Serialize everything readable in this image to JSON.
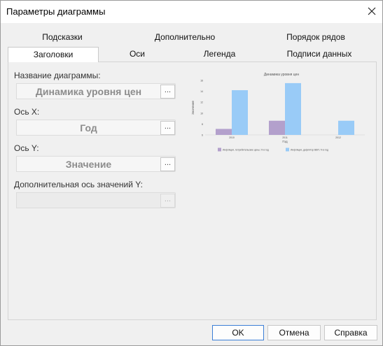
{
  "window": {
    "title": "Параметры диаграммы"
  },
  "tabs_row1": [
    "Подсказки",
    "Дополнительно",
    "Порядок рядов"
  ],
  "tabs_row2": [
    "Заголовки",
    "Оси",
    "Легенда",
    "Подписи данных"
  ],
  "fields": {
    "chart_title": {
      "label": "Название диаграммы:",
      "value": "Динамика уровня цен"
    },
    "x_axis": {
      "label": "Ось X:",
      "value": "Год"
    },
    "y_axis": {
      "label": "Ось Y:",
      "value": "Значение"
    },
    "extra_axis": {
      "label": "Дополнительная ось значений Y:",
      "value": ""
    },
    "browse": "..."
  },
  "chart_data": {
    "type": "bar",
    "title": "Динамика уровня цен",
    "xlabel": "Год",
    "ylabel": "Значение",
    "categories": [
      "2010",
      "2011",
      "2012"
    ],
    "ylim": [
      6,
      16
    ],
    "yticks": [
      "16",
      "14",
      "12",
      "10",
      "8",
      "6"
    ],
    "series": [
      {
        "name": "Инфляция, потребительские цены, % в год",
        "values": [
          7.1,
          8.6,
          5.1
        ],
        "color": "#b3a0cc"
      },
      {
        "name": "Инфляция, дефлятор ВВП, % в год",
        "values": [
          14.2,
          15.5,
          8.6
        ],
        "color": "#99cbf7"
      }
    ]
  },
  "buttons": {
    "ok": "OK",
    "cancel": "Отмена",
    "help": "Справка"
  }
}
